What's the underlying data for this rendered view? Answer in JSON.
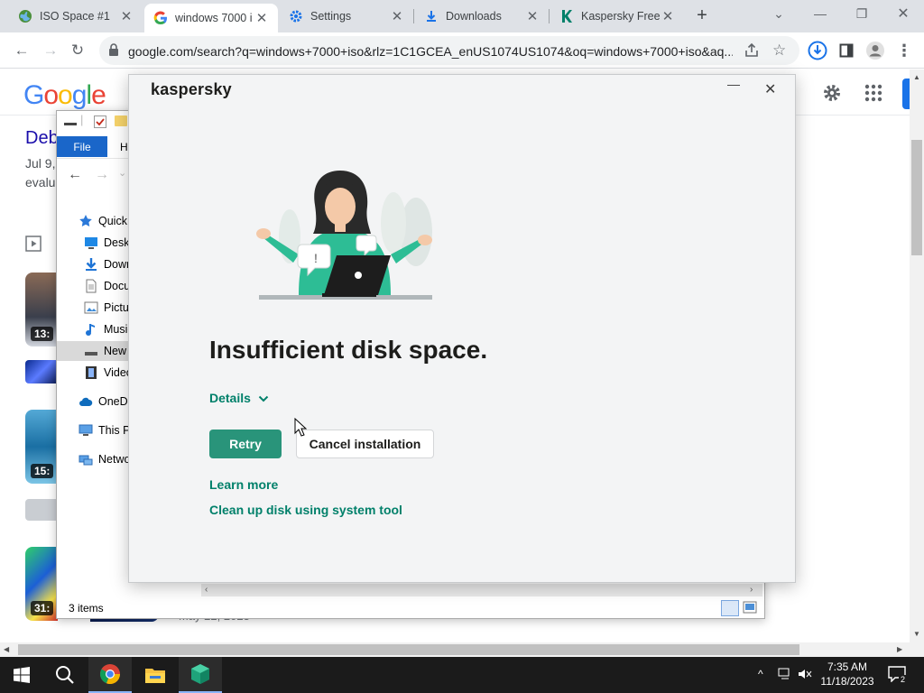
{
  "browser": {
    "tabs": [
      {
        "title": "ISO Space #1",
        "icon": "globe-icon"
      },
      {
        "title": "windows 7000 i",
        "icon": "google-icon"
      },
      {
        "title": "Settings",
        "icon": "gear-icon"
      },
      {
        "title": "Downloads",
        "icon": "download-icon"
      },
      {
        "title": "Kaspersky Free",
        "icon": "kaspersky-k-icon"
      }
    ],
    "url": "google.com/search?q=windows+7000+iso&rlz=1C1GCEA_enUS1074US1074&oq=windows+7000+iso&aq..."
  },
  "google": {
    "logo": "Google",
    "result_title": "Deb",
    "result_snippet_1": "Jul 9,",
    "result_snippet_2": "evalu",
    "video_durations": [
      "13:",
      "15:",
      "31:"
    ],
    "date_text": "May 22, 2023"
  },
  "explorer": {
    "menu_file": "File",
    "menu_home": "He",
    "nav_items": [
      "Quick a",
      "Deskt",
      "Down",
      "Docu",
      "Pictu",
      "Music",
      "New V",
      "Video",
      "OneDri",
      "This PC",
      "Netwo"
    ],
    "status": "3 items"
  },
  "kaspersky": {
    "brand": "kaspersky",
    "title": "Insufficient disk space.",
    "details_label": "Details",
    "retry_label": "Retry",
    "cancel_label": "Cancel installation",
    "learn_more": "Learn more",
    "cleanup_link": "Clean up disk using system tool",
    "accent_color": "#29947a"
  },
  "taskbar": {
    "time": "7:35 AM",
    "date": "11/18/2023",
    "notification_count": "2"
  }
}
